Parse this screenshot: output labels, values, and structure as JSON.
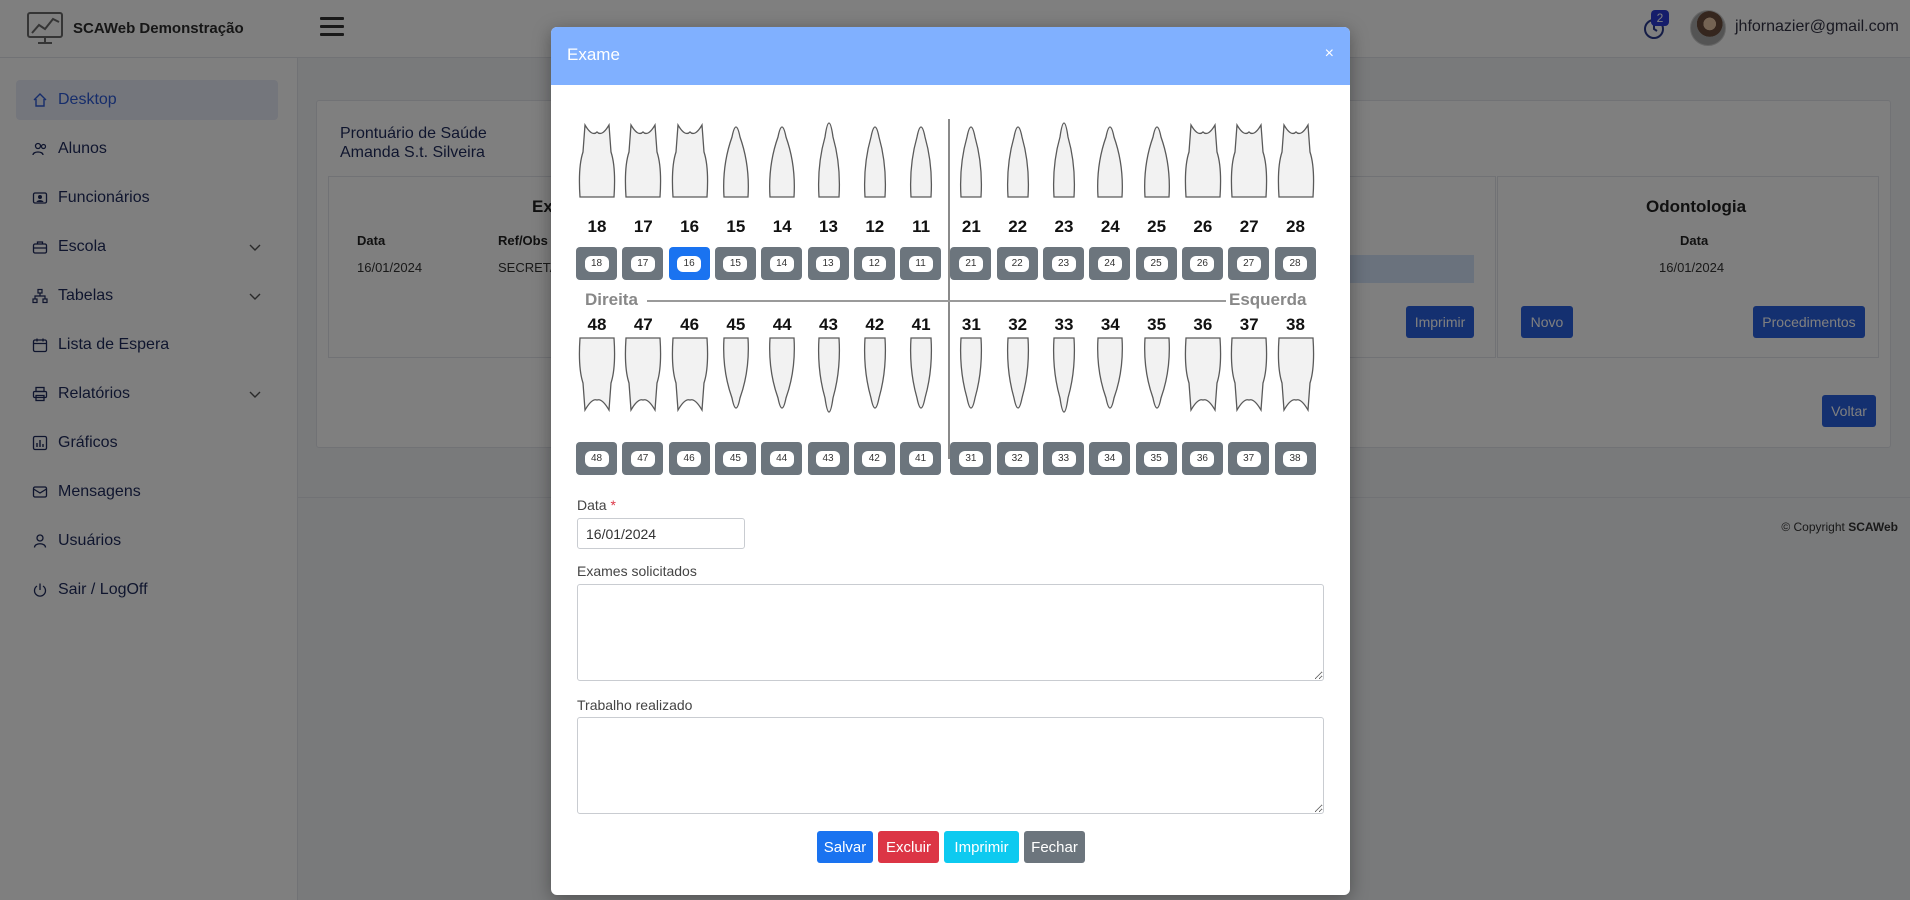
{
  "app": {
    "brand_name": "SCAWeb Demonstração",
    "notification_count": "2",
    "user_email": "jhfornazier@gmail.com"
  },
  "sidebar": {
    "items": [
      {
        "label": "Desktop",
        "icon": "home-icon",
        "active": true
      },
      {
        "label": "Alunos",
        "icon": "users-icon"
      },
      {
        "label": "Funcionários",
        "icon": "id-card-icon"
      },
      {
        "label": "Escola",
        "icon": "briefcase-icon",
        "expandable": true
      },
      {
        "label": "Tabelas",
        "icon": "sitemap-icon",
        "expandable": true
      },
      {
        "label": "Lista de Espera",
        "icon": "calendar-icon"
      },
      {
        "label": "Relatórios",
        "icon": "printer-icon",
        "expandable": true
      },
      {
        "label": "Gráficos",
        "icon": "chart-icon"
      },
      {
        "label": "Mensagens",
        "icon": "messages-icon"
      },
      {
        "label": "Usuários",
        "icon": "user-icon"
      },
      {
        "label": "Sair / LogOff",
        "icon": "power-icon"
      }
    ]
  },
  "main": {
    "record_title": "Prontuário de Saúde",
    "patient_name": "Amanda S.t. Silveira",
    "exams_panel": {
      "title": "Ex",
      "col_date": "Data",
      "col_ref": "Ref/Obs",
      "row_date": "16/01/2024",
      "row_ref": "SECRETA",
      "print_label": "Imprimir"
    },
    "odonto_panel": {
      "title": "Odontologia",
      "col_date": "Data",
      "row_date": "16/01/2024",
      "new_label": "Novo",
      "procedures_label": "Procedimentos"
    },
    "back_label": "Voltar",
    "copyright_prefix": "© Copyright ",
    "copyright_brand": "SCAWeb"
  },
  "modal": {
    "title": "Exame",
    "close_symbol": "×",
    "upper_teeth": [
      "18",
      "17",
      "16",
      "15",
      "14",
      "13",
      "12",
      "11",
      "21",
      "22",
      "23",
      "24",
      "25",
      "26",
      "27",
      "28"
    ],
    "lower_teeth": [
      "48",
      "47",
      "46",
      "45",
      "44",
      "43",
      "42",
      "41",
      "31",
      "32",
      "33",
      "34",
      "35",
      "36",
      "37",
      "38"
    ],
    "selected_tooth": "16",
    "right_label": "Direita",
    "left_label": "Esquerda",
    "date_label": "Data",
    "required_mark": "*",
    "date_value": "16/01/2024",
    "exams_label": "Exames solicitados",
    "exams_value": "",
    "work_label": "Trabalho realizado",
    "work_value": "",
    "buttons": {
      "save": "Salvar",
      "delete": "Excluir",
      "print": "Imprimir",
      "close": "Fechar"
    }
  },
  "colors": {
    "primary": "#2960e0",
    "modal_header": "#80b0ff",
    "save": "#1a73f0",
    "delete": "#dc3545",
    "print": "#0dcaf0",
    "close": "#6c757d",
    "tooth_button": "#6c757d",
    "tooth_selected": "#1a73f0"
  }
}
